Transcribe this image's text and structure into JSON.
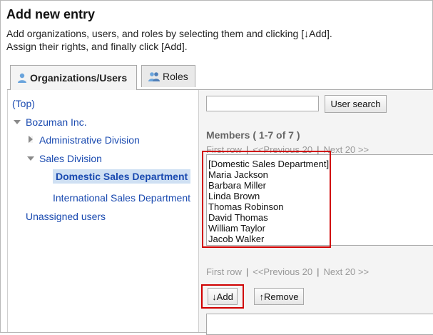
{
  "header": {
    "title": "Add new entry",
    "desc_line1": "Add organizations, users, and roles by selecting them and clicking [↓Add].",
    "desc_line2": "Assign their rights, and finally click [Add]."
  },
  "tabs": [
    {
      "label": "Organizations/Users",
      "icon": "users-icon",
      "active": true
    },
    {
      "label": "Roles",
      "icon": "roles-icon",
      "active": false
    }
  ],
  "tree": {
    "top": "(Top)",
    "company": "Bozuman Inc.",
    "admin_division": "Administrative Division",
    "sales_division": "Sales Division",
    "domestic": "Domestic Sales Department",
    "international": "International Sales Department",
    "unassigned": "Unassigned users"
  },
  "search": {
    "placeholder": "",
    "button_label": "User search"
  },
  "members": {
    "heading": "Members ( 1-7 of 7 )",
    "items": [
      "[Domestic Sales Department]",
      "Maria Jackson",
      "Barbara Miller",
      "Linda Brown",
      "Thomas Robinson",
      "David Thomas",
      "William Taylor",
      "Jacob Walker"
    ]
  },
  "pager": {
    "first": "First row",
    "sep": "|",
    "prev": "<<Previous 20",
    "next": "Next 20 >>"
  },
  "actions": {
    "add_label": "↓Add",
    "remove_label": "↑Remove"
  },
  "colors": {
    "link": "#1a4ab0",
    "highlight": "#d00000",
    "selected_bg": "#cfe0f3"
  }
}
